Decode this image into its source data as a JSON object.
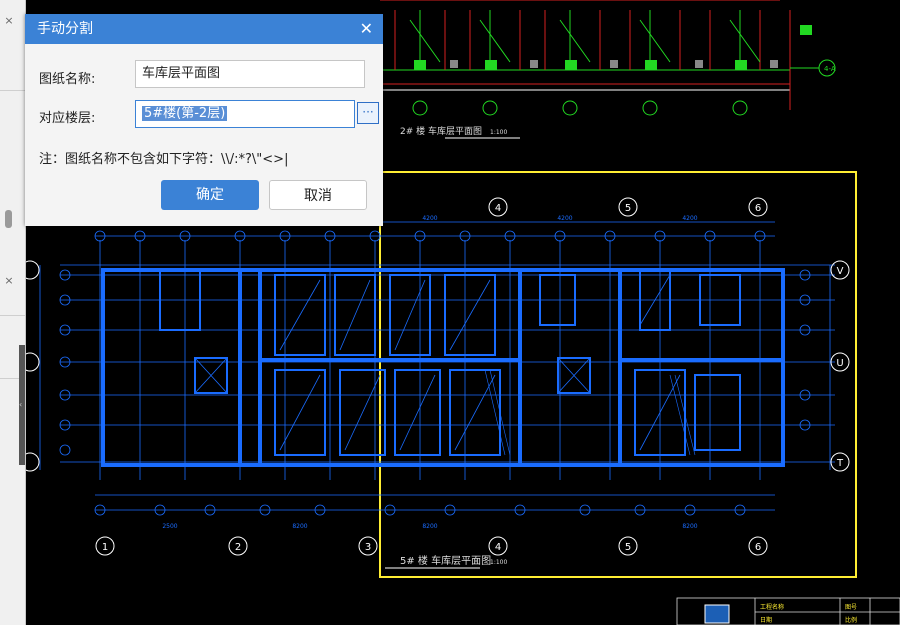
{
  "dialog": {
    "title": "手动分割",
    "close_glyph": "✕",
    "drawing_name_label": "图纸名称:",
    "drawing_name_value": "车库层平面图",
    "floor_label": "对应楼层:",
    "floor_value": "5#楼(第-2层)",
    "browse_glyph": "···",
    "note": "注：图纸名称不包含如下字符：\\\\/:*?\\\"<>|",
    "ok_label": "确定",
    "cancel_label": "取消"
  },
  "left_panel": {
    "close_glyph": "×",
    "close_glyph_2": "×",
    "collapse_glyph": "‹"
  },
  "drawing": {
    "upper_title": "2# 楼 车库层平面图",
    "upper_scale": "1:100",
    "main_title": "5# 楼 车库层平面图",
    "main_scale": "1:100",
    "axis_numbers": [
      "1",
      "2",
      "3",
      "4",
      "5",
      "6"
    ],
    "axis_letters": [
      "V",
      "U",
      "T"
    ],
    "top_tag": "A",
    "top_tag_2": "4-A",
    "dim_top": [
      "4200",
      "4200",
      "4200",
      "4200"
    ],
    "dim_bottom": [
      "2500",
      "8200",
      "8200",
      "8200"
    ],
    "title_block_cells": [
      "工程名称",
      "图号",
      "日期",
      "比例"
    ]
  },
  "colors": {
    "accent": "#3b82d6",
    "plan_blue": "#1a6cff",
    "border_yellow": "#ffee33",
    "green": "#22d822",
    "red": "#d42020"
  }
}
